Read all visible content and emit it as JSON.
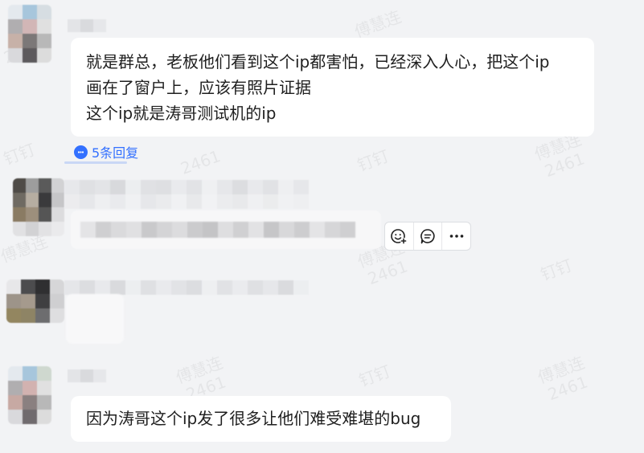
{
  "messages": [
    {
      "lines": [
        "就是群总，老板他们看到这个ip都害怕，已经深入人心，把这个ip",
        "画在了窗户上，应该有照片证据",
        "这个ip就是涛哥测试机的ip"
      ],
      "reply_count_label": "5条回复"
    },
    {
      "lines": [
        "因为涛哥这个ip发了很多让他们难受难堪的bug"
      ]
    }
  ],
  "watermark": {
    "name": "傅慧连",
    "number": "2461",
    "app": "钉钉"
  },
  "toolbar": {
    "icons": [
      "add-reaction-icon",
      "reply-comment-icon",
      "more-icon"
    ]
  },
  "colors": {
    "background": "#f2f3f5",
    "bubble": "#ffffff",
    "link": "#3370ff",
    "text": "#1f1f1f"
  }
}
